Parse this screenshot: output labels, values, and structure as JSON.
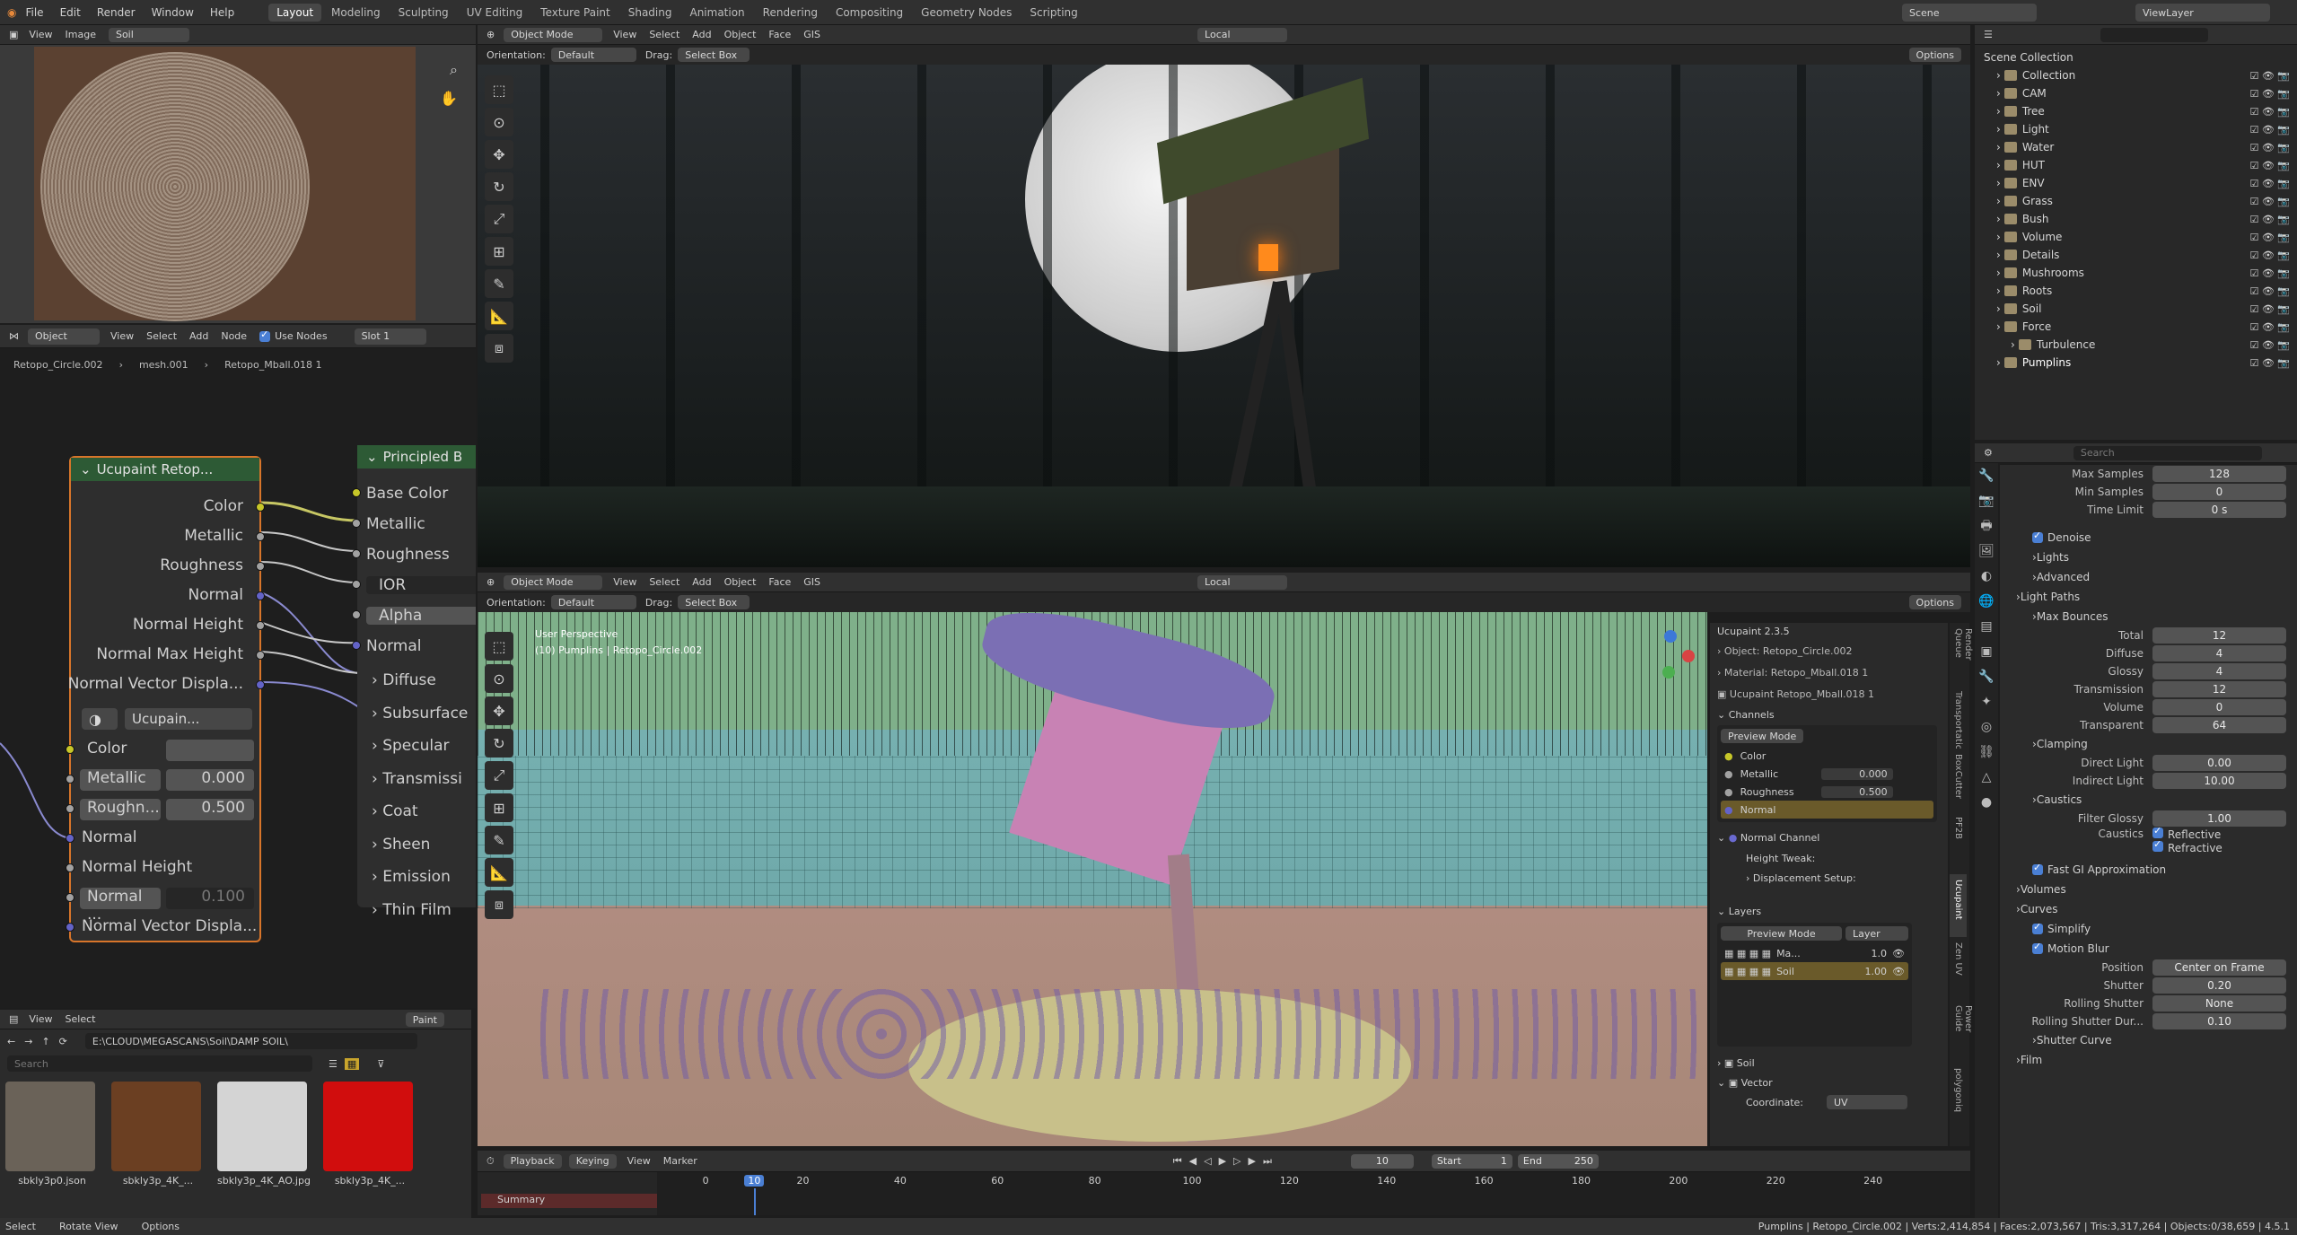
{
  "topbar": {
    "menus": [
      "File",
      "Edit",
      "Render",
      "Window",
      "Help"
    ],
    "workspaces": [
      "Layout",
      "Modeling",
      "Sculpting",
      "UV Editing",
      "Texture Paint",
      "Shading",
      "Animation",
      "Rendering",
      "Compositing",
      "Geometry Nodes",
      "Scripting"
    ],
    "active_workspace": "Layout",
    "scene": "Scene",
    "view_layer": "ViewLayer"
  },
  "image_editor": {
    "menus": [
      "View",
      "Image"
    ],
    "image_name": "Soil"
  },
  "node_editor": {
    "mode": "Object",
    "menus": [
      "View",
      "Select",
      "Add",
      "Node"
    ],
    "use_nodes": "Use Nodes",
    "slot": "Slot 1",
    "breadcrumb": [
      "Retopo_Circle.002",
      "mesh.001",
      "Retopo_Mball.018 1"
    ],
    "ucupaint_node": {
      "title": "Ucupaint Retop...",
      "outputs": [
        "Color",
        "Metallic",
        "Roughness",
        "Normal",
        "Normal Height",
        "Normal Max Height",
        "Normal Vector Displa..."
      ],
      "group_label": "Ucupain...",
      "inputs": [
        {
          "label": "Color",
          "value": ""
        },
        {
          "label": "Metallic",
          "value": "0.000"
        },
        {
          "label": "Roughn...",
          "value": "0.500"
        },
        {
          "label": "Normal",
          "value": ""
        },
        {
          "label": "Normal Height",
          "value": ""
        },
        {
          "label": "Normal ...",
          "value": "0.100"
        },
        {
          "label": "Normal Vector Displa...",
          "value": ""
        }
      ]
    },
    "principled_node": {
      "title": "Principled B",
      "inputs": [
        "Base Color",
        "Metallic",
        "Roughness",
        "IOR",
        "Alpha",
        "Normal"
      ],
      "panels": [
        "Diffuse",
        "Subsurface",
        "Specular",
        "Transmissi",
        "Coat",
        "Sheen",
        "Emission",
        "Thin Film"
      ]
    }
  },
  "file_browser": {
    "menus": [
      "View",
      "Select"
    ],
    "paint": "Paint",
    "path": "E:\\CLOUD\\MEGASCANS\\Soil\\DAMP SOIL\\",
    "search": "Search",
    "files": [
      {
        "name": "sbkly3p0.json",
        "color": "#6a6258"
      },
      {
        "name": "sbkly3p_4K_...",
        "color": "#6b3f22"
      },
      {
        "name": "sbkly3p_4K_AO.jpg",
        "color": "#d4d4d4"
      },
      {
        "name": "sbkly3p_4K_...",
        "color": "#d10d0d"
      }
    ]
  },
  "viewport_top": {
    "mode": "Object Mode",
    "menus": [
      "View",
      "Select",
      "Add",
      "Object",
      "Face",
      "GIS"
    ],
    "orientation_label": "Orientation:",
    "orientation": "Default",
    "drag_label": "Drag:",
    "drag": "Select Box",
    "transform": "Local",
    "options": "Options"
  },
  "viewport_bottom": {
    "mode": "Object Mode",
    "menus": [
      "View",
      "Select",
      "Add",
      "Object",
      "Face",
      "GIS"
    ],
    "orientation_label": "Orientation:",
    "orientation": "Default",
    "drag_label": "Drag:",
    "drag": "Select Box",
    "transform": "Local",
    "options": "Options",
    "overlay_title": "User Perspective",
    "overlay_sub": "(10) Pumplins | Retopo_Circle.002"
  },
  "ucupaint_panel": {
    "version": "Ucupaint 2.3.5",
    "object": "Object: Retopo_Circle.002",
    "material": "Material: Retopo_Mball.018 1",
    "node": "Ucupaint Retopo_Mball.018 1",
    "channels_header": "Channels",
    "preview_mode": "Preview Mode",
    "channels": [
      {
        "name": "Color",
        "value": ""
      },
      {
        "name": "Metallic",
        "value": "0.000"
      },
      {
        "name": "Roughness",
        "value": "0.500"
      },
      {
        "name": "Normal",
        "value": ""
      }
    ],
    "normal_channel": "Normal Channel",
    "height_tweak": "Height Tweak:",
    "displacement": "Displacement Setup:",
    "layers_header": "Layers",
    "layer_dropdown": "Layer",
    "layers": [
      {
        "name": "Ma...",
        "value": "1.0"
      },
      {
        "name": "Soil",
        "value": "1.00"
      }
    ],
    "soil": "Soil",
    "vector": "Vector",
    "coordinate": "Coordinate:",
    "coord_val": "UV"
  },
  "side_tabs": [
    "Render Queue",
    "Transportation",
    "BoxCutter",
    "PF2B",
    "Ucupaint",
    "Zen UV",
    "Power Guide",
    "polygoniq"
  ],
  "timeline": {
    "menus": [
      "Playback",
      "Keying",
      "View",
      "Marker"
    ],
    "frames": [
      "0",
      "10",
      "20",
      "40",
      "60",
      "80",
      "100",
      "120",
      "140",
      "160",
      "180",
      "200",
      "220",
      "240"
    ],
    "current": "10",
    "start_label": "Start",
    "start": "1",
    "end_label": "End",
    "end": "250",
    "frame_field": "10",
    "summary": "Summary"
  },
  "outliner": {
    "header": "Scene Collection",
    "items": [
      {
        "name": "Collection",
        "depth": 1
      },
      {
        "name": "CAM",
        "depth": 1
      },
      {
        "name": "Tree",
        "depth": 1
      },
      {
        "name": "Light",
        "depth": 1
      },
      {
        "name": "Water",
        "depth": 1
      },
      {
        "name": "HUT",
        "depth": 1
      },
      {
        "name": "ENV",
        "depth": 1
      },
      {
        "name": "Grass",
        "depth": 1
      },
      {
        "name": "Bush",
        "depth": 1
      },
      {
        "name": "Volume",
        "depth": 1
      },
      {
        "name": "Details",
        "depth": 1
      },
      {
        "name": "Mushrooms",
        "depth": 1
      },
      {
        "name": "Roots",
        "depth": 1
      },
      {
        "name": "Soil",
        "depth": 1
      },
      {
        "name": "Force",
        "depth": 1
      },
      {
        "name": "Turbulence",
        "depth": 2
      },
      {
        "name": "Pumplins",
        "depth": 1
      }
    ]
  },
  "properties": {
    "search": "Search",
    "rows": [
      {
        "k": "prop",
        "label": "Max Samples",
        "value": "128"
      },
      {
        "k": "prop",
        "label": "Min Samples",
        "value": "0"
      },
      {
        "k": "prop",
        "label": "Time Limit",
        "value": "0 s"
      },
      {
        "k": "gap"
      },
      {
        "k": "check",
        "label": "Denoise"
      },
      {
        "k": "sub",
        "label": "Lights"
      },
      {
        "k": "sub",
        "label": "Advanced"
      },
      {
        "k": "sec",
        "label": "Light Paths"
      },
      {
        "k": "sub",
        "label": "Max Bounces"
      },
      {
        "k": "prop",
        "label": "Total",
        "value": "12"
      },
      {
        "k": "prop",
        "label": "Diffuse",
        "value": "4"
      },
      {
        "k": "prop",
        "label": "Glossy",
        "value": "4"
      },
      {
        "k": "prop",
        "label": "Transmission",
        "value": "12"
      },
      {
        "k": "prop",
        "label": "Volume",
        "value": "0"
      },
      {
        "k": "prop",
        "label": "Transparent",
        "value": "64"
      },
      {
        "k": "sub",
        "label": "Clamping"
      },
      {
        "k": "prop",
        "label": "Direct Light",
        "value": "0.00"
      },
      {
        "k": "prop",
        "label": "Indirect Light",
        "value": "10.00"
      },
      {
        "k": "sub",
        "label": "Caustics"
      },
      {
        "k": "prop",
        "label": "Filter Glossy",
        "value": "1.00"
      },
      {
        "k": "pair",
        "label": "Caustics",
        "a": "Reflective",
        "b": "Refractive"
      },
      {
        "k": "check",
        "label": "Fast GI Approximation"
      },
      {
        "k": "sec",
        "label": "Volumes"
      },
      {
        "k": "sec",
        "label": "Curves"
      },
      {
        "k": "check",
        "label": "Simplify"
      },
      {
        "k": "check",
        "label": "Motion Blur"
      },
      {
        "k": "prop",
        "label": "Position",
        "value": "Center on Frame"
      },
      {
        "k": "prop",
        "label": "Shutter",
        "value": "0.20"
      },
      {
        "k": "prop",
        "label": "Rolling Shutter",
        "value": "None"
      },
      {
        "k": "prop",
        "label": "Rolling Shutter Dur...",
        "value": "0.10"
      },
      {
        "k": "sub",
        "label": "Shutter Curve"
      },
      {
        "k": "sec",
        "label": "Film"
      }
    ]
  },
  "statusbar": {
    "left": [
      "Select",
      "Rotate View",
      "Options"
    ],
    "right": "Pumplins | Retopo_Circle.002 | Verts:2,414,854 | Faces:2,073,567 | Tris:3,317,264 | Objects:0/38,659 | 4.5.1"
  },
  "colors": {
    "accent": "#4a7fd4",
    "header": "#303030",
    "node_header_green": "#2f6f3a",
    "node_header_orange": "#c86a1a",
    "socket_yellow": "#c7c729",
    "socket_grey": "#a1a1a1",
    "socket_purple": "#6363c7"
  }
}
